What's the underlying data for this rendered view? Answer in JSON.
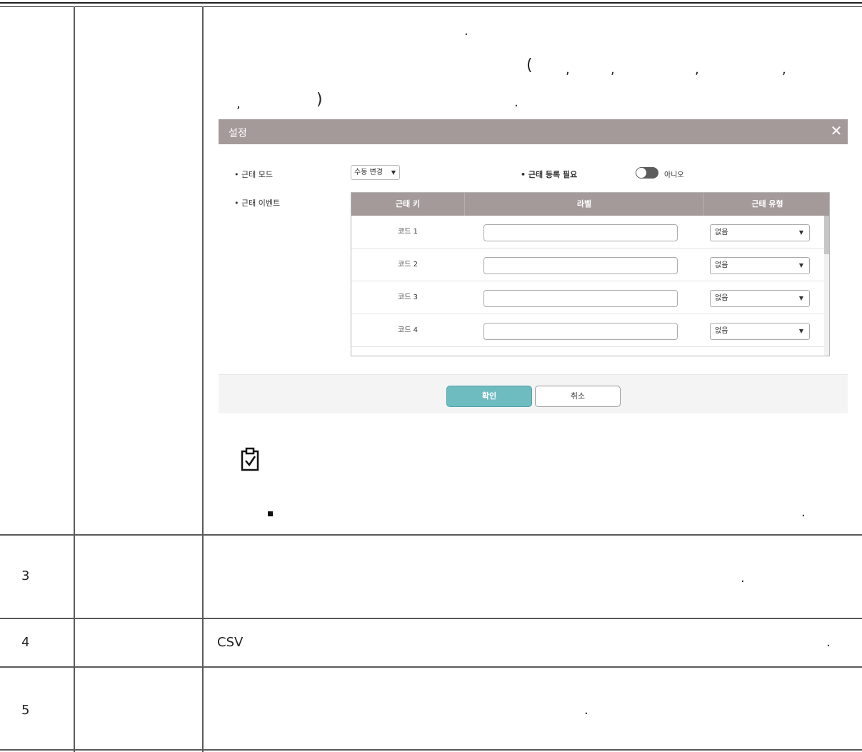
{
  "table_rows": [
    {
      "num": ""
    },
    {
      "num": "3"
    },
    {
      "num": "4"
    },
    {
      "num": "5"
    }
  ],
  "body_text": {
    "row1_line1_dot": ".",
    "row1_line2_paren": "(",
    "row1_line2_commas": [
      ",",
      ",",
      ",",
      ","
    ],
    "row1_line3_comma": ",",
    "row1_line3_paren": ")",
    "row1_line3_dot": ".",
    "note_dot": ".",
    "row3_dot": ".",
    "row4_csv": "CSV",
    "row4_dot": ".",
    "row5_dot": "."
  },
  "dialog": {
    "title": "설정",
    "close_glyph": "✕",
    "attendance_mode_label": "• 근태 모드",
    "attendance_mode_value": "수동 변경",
    "registration_required_label": "• 근태 등록 필요",
    "registration_toggle_value": "아니오",
    "attendance_event_label": "• 근태 이벤트",
    "columns": [
      "근태 키",
      "라벨",
      "근태 유형"
    ],
    "rows": [
      {
        "key": "코드 1",
        "label": "",
        "type": "없음"
      },
      {
        "key": "코드 2",
        "label": "",
        "type": "없음"
      },
      {
        "key": "코드 3",
        "label": "",
        "type": "없음"
      },
      {
        "key": "코드 4",
        "label": "",
        "type": "없음"
      }
    ],
    "confirm_label": "확인",
    "cancel_label": "취소"
  },
  "icons": {
    "note": "clipboard-check-icon",
    "bullet": "square-bullet-icon"
  },
  "colors": {
    "header_bg": "#a59a9a",
    "confirm_bg": "#6fbcc0",
    "rule": "#5a5a5a"
  }
}
